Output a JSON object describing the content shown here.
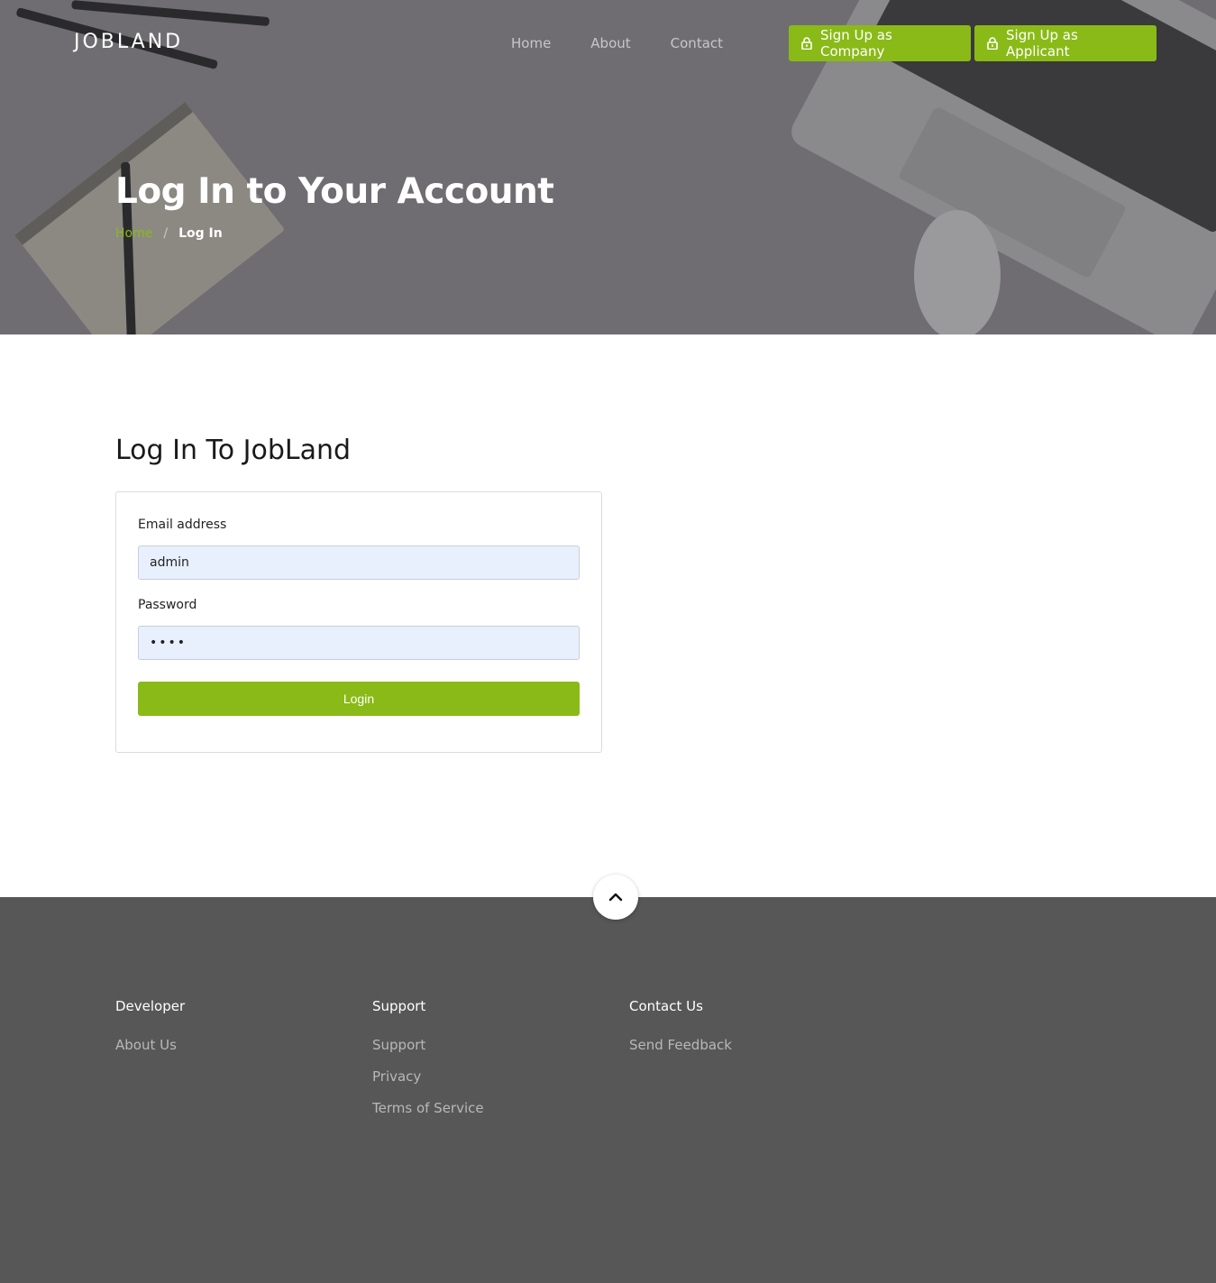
{
  "header": {
    "brand": "JOBLAND",
    "nav": [
      {
        "label": "Home"
      },
      {
        "label": "About"
      },
      {
        "label": "Contact"
      }
    ],
    "signup_company_label": "Sign Up as Company",
    "signup_applicant_label": "Sign Up as Applicant",
    "button_icon": "lock-icon"
  },
  "hero": {
    "title": "Log In to Your Account",
    "breadcrumb": {
      "home": "Home",
      "separator": "/",
      "current": "Log In"
    }
  },
  "login": {
    "title": "Log In To JobLand",
    "email_label": "Email address",
    "email_value": "admin",
    "password_label": "Password",
    "password_value": "••••",
    "submit_label": "Login"
  },
  "footer": {
    "columns": [
      {
        "heading": "Developer",
        "links": [
          "About Us"
        ]
      },
      {
        "heading": "Support",
        "links": [
          "Support",
          "Privacy",
          "Terms of Service"
        ]
      },
      {
        "heading": "Contact Us",
        "links": [
          "Send Feedback"
        ]
      }
    ],
    "back_to_top_icon": "chevron-up-icon"
  },
  "colors": {
    "accent": "#8aba17",
    "hero_overlay": "#6f6d71",
    "footer_bg": "#575757",
    "input_bg": "#e8f0fe"
  }
}
